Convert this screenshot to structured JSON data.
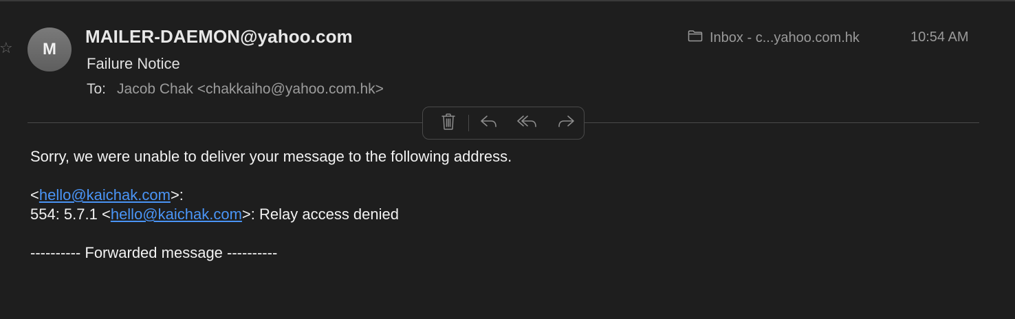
{
  "message": {
    "avatar_initial": "M",
    "sender": "MAILER-DAEMON@yahoo.com",
    "subject": "Failure Notice",
    "to_label": "To:",
    "to_value": "Jacob Chak <chakkaiho@yahoo.com.hk>",
    "mailbox": "Inbox - c...yahoo.com.hk",
    "time": "10:54 AM",
    "star_icon": "star-icon"
  },
  "toolbar": {
    "icons": [
      "trash-icon",
      "reply-icon",
      "reply-all-icon",
      "forward-icon"
    ]
  },
  "body": {
    "line1": "Sorry, we were unable to deliver your message to the following address.",
    "addr_open": "<",
    "addr_link": "hello@kaichak.com",
    "addr_close": ">:",
    "code_prefix": "554: 5.7.1 <",
    "code_link": "hello@kaichak.com",
    "code_suffix": ">: Relay access denied",
    "forwarded": "---------- Forwarded message ----------"
  },
  "colors": {
    "background": "#1e1e1e",
    "link": "#4a95f7"
  }
}
